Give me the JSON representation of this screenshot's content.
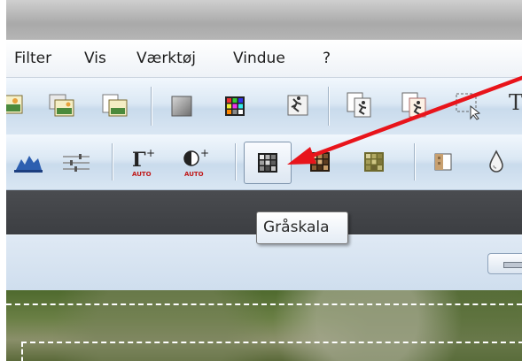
{
  "menu": {
    "items": [
      {
        "label": "Filter"
      },
      {
        "label": "Vis"
      },
      {
        "label": "Værktøj"
      },
      {
        "label": "Vindue"
      },
      {
        "label": "?"
      }
    ]
  },
  "toolbar1": {
    "icons": [
      "image-icon",
      "image-layers-icon",
      "image-copy-icon",
      "gray-square-icon",
      "color-grid-icon",
      "film-runner-icon",
      "export-person-icon",
      "import-person-icon",
      "select-region-icon",
      "text-icon"
    ]
  },
  "toolbar2": {
    "icons": [
      "histogram-icon",
      "sliders-icon",
      "auto-gamma-icon",
      "auto-contrast-icon",
      "grayscale-icon",
      "sepia-icon",
      "tint-icon",
      "half-contrast-icon",
      "drop-icon"
    ],
    "auto_gamma_label": "AUTO",
    "auto_contrast_label": "AUTO"
  },
  "tooltip": {
    "text": "Gråskala"
  },
  "colors": {
    "annotation_arrow": "#e8141b",
    "toolbar_top": "#f1f7fd",
    "toolbar_bottom": "#c9dbec",
    "dark_strip": "#45474b"
  }
}
